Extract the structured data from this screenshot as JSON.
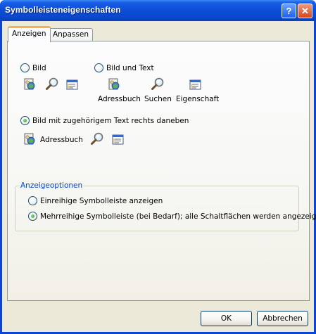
{
  "window": {
    "title": "Symbolleisteneigenschaften",
    "help_glyph": "?",
    "close_glyph": "✕"
  },
  "tabs": [
    {
      "label": "Anzeigen",
      "active": true
    },
    {
      "label": "Anpassen",
      "active": false
    }
  ],
  "display_modes": {
    "bild": {
      "label": "Bild",
      "checked": false
    },
    "bild_und_text": {
      "label": "Bild und Text",
      "checked": false,
      "captions": [
        "Adressbuch",
        "Suchen",
        "Eigenschaft"
      ]
    },
    "bild_text_rechts": {
      "label": "Bild mit zugehörigem Text rechts daneben",
      "checked": true,
      "caption": "Adressbuch"
    }
  },
  "icons": [
    "address-book-icon",
    "search-icon",
    "properties-icon"
  ],
  "options_group": {
    "title": "Anzeigeoptionen",
    "single_row": {
      "label": "Einreihige Symbolleiste anzeigen",
      "checked": false
    },
    "multi_row": {
      "label": "Mehrreihige Symbolleiste (bei Bedarf); alle Schaltflächen werden angezeigt",
      "checked": true
    }
  },
  "buttons": {
    "ok": "OK",
    "cancel": "Abbrechen"
  },
  "colors": {
    "title_bar": "#0a49d0",
    "dialog_face": "#ece9d8",
    "active_tab_accent": "#f8b347",
    "group_title": "#0046d5",
    "radio_checked": "#21a121"
  }
}
